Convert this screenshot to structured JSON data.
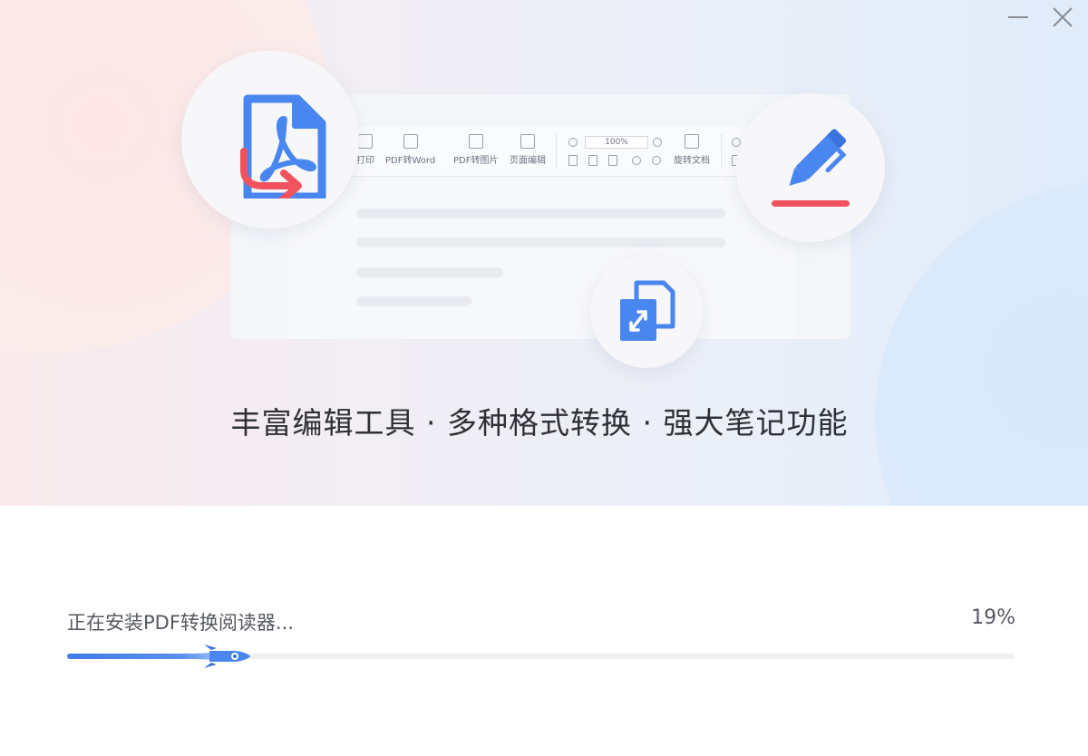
{
  "window": {
    "minimize_icon": "minimize-icon",
    "close_icon": "close-icon"
  },
  "hero": {
    "tagline": "丰富编辑工具 · 多种格式转换 · 强大笔记功能",
    "features": [
      {
        "icon": "pdf-convert-icon"
      },
      {
        "icon": "pen-annotate-icon"
      },
      {
        "icon": "format-convert-icon"
      }
    ],
    "mock_toolbar": {
      "items": [
        "打印",
        "PDF转Word",
        "PDF转图片",
        "页面编辑",
        "旋转文档"
      ],
      "zoom": "100%"
    }
  },
  "install": {
    "status": "正在安装PDF转换阅读器...",
    "percent_label": "19%",
    "progress": 0.19
  },
  "colors": {
    "accent_blue": "#4a86f0",
    "accent_red": "#f0525e"
  }
}
